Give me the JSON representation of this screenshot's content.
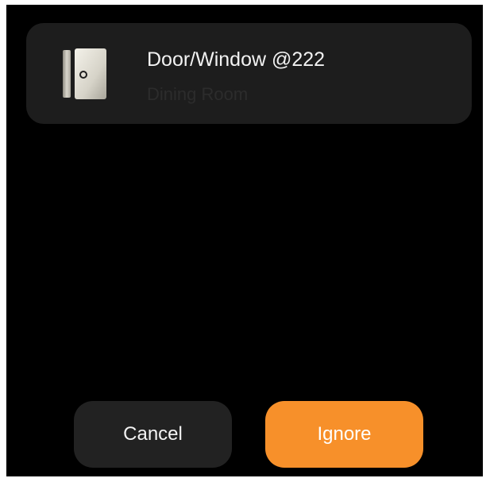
{
  "device": {
    "name": "Door/Window @222",
    "room": "Dining Room",
    "icon": "door-window-sensor-icon"
  },
  "actions": {
    "cancel_label": "Cancel",
    "ignore_label": "Ignore"
  },
  "colors": {
    "background": "#000000",
    "card": "#1d1d1d",
    "cancel_button": "#222222",
    "ignore_button": "#f7902a",
    "primary_text": "#f2f2f2",
    "secondary_text": "#2c2c2c"
  }
}
